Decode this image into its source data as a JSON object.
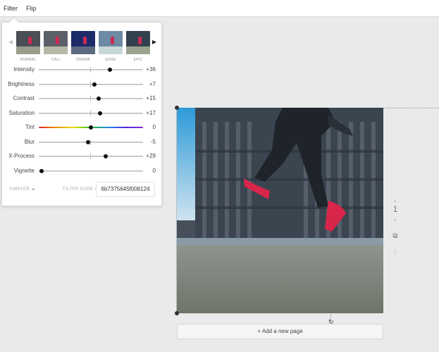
{
  "topbar": {
    "filter_label": "Filter",
    "flip_label": "Flip"
  },
  "filter_panel": {
    "presets": [
      {
        "label": "NORMAL",
        "tone": "#4a4e55",
        "pave": "#9a9c8c"
      },
      {
        "label": "CALI",
        "tone": "#5c6068",
        "pave": "#b6b9a6"
      },
      {
        "label": "DRAMA",
        "tone": "#1d2a6a",
        "pave": "#5c6a80"
      },
      {
        "label": "EDGE",
        "tone": "#6e8aa4",
        "pave": "#c9d7d8"
      },
      {
        "label": "EPIC",
        "tone": "#33414f",
        "pave": "#9aa38e"
      }
    ],
    "arrow_left": "◀",
    "arrow_right": "▶",
    "sliders": [
      {
        "name": "Intensity",
        "value": "+36",
        "level": 36
      },
      {
        "name": "Brightness",
        "value": "+7",
        "level": 7
      },
      {
        "name": "Contrast",
        "value": "+15",
        "level": 15
      },
      {
        "name": "Saturation",
        "value": "+17",
        "level": 17
      },
      {
        "name": "Tint",
        "value": "0",
        "level": 0
      },
      {
        "name": "Blur",
        "value": "-5",
        "level": -5
      },
      {
        "name": "X-Process",
        "value": "+29",
        "level": 29
      },
      {
        "name": "Vignette",
        "value": "0",
        "level": 0
      }
    ],
    "simpler_label": "SIMPLER ▲",
    "filter_code_label": "FILTER CODE #",
    "filter_code": "6b7375645f008124"
  },
  "canvas": {
    "page_number": "1",
    "up_icon": "▲",
    "down_icon": "▼",
    "copy_icon": "⧉",
    "trash_icon": "▯",
    "rotate_icon": "↻",
    "add_page_label": "+ Add a new page"
  },
  "colors": {
    "knob": "#111111",
    "track": "#c8cbce"
  }
}
